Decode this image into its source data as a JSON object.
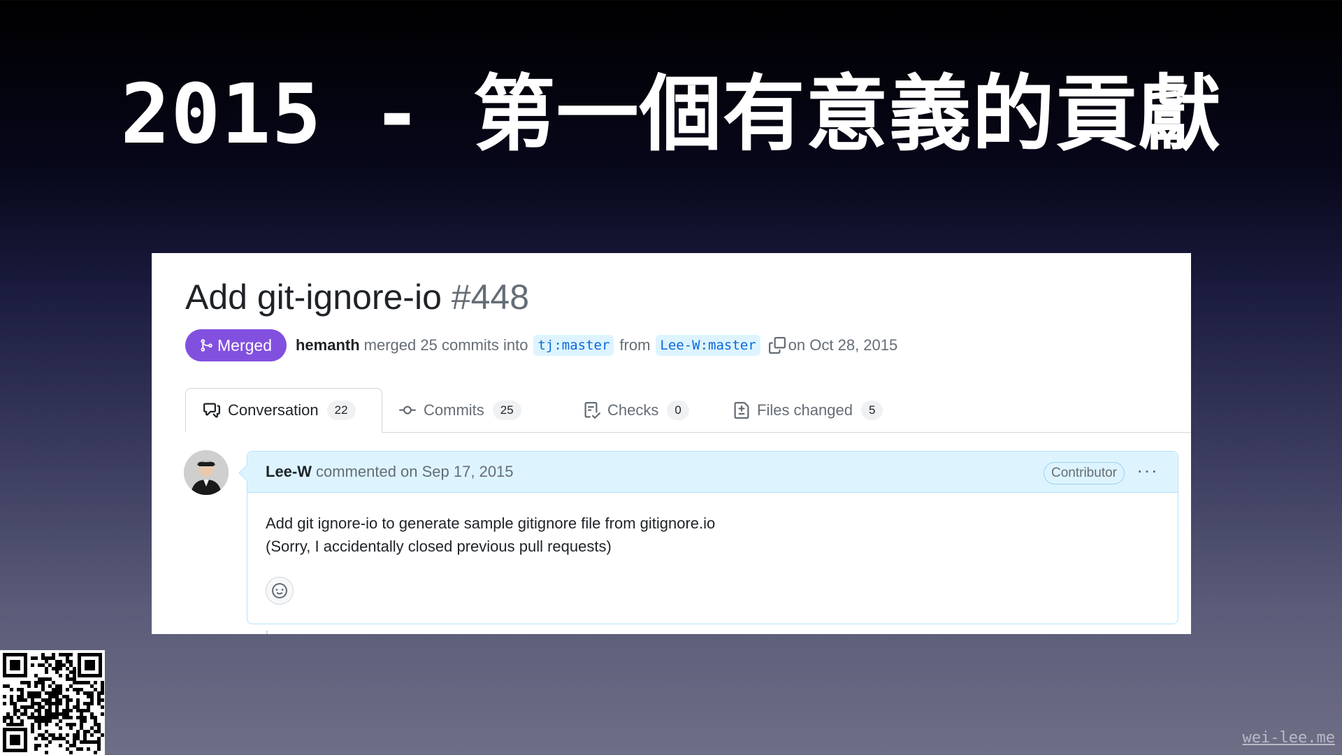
{
  "slide": {
    "title": "2015 - 第一個有意義的貢獻",
    "footer_url": "wei-lee.me"
  },
  "pull_request": {
    "title": "Add git-ignore-io",
    "number": "#448",
    "state_label": "Merged",
    "merged_by": "hemanth",
    "merge_text": "merged 25 commits into",
    "base_branch": "tj:master",
    "from_text": "from",
    "head_branch": "Lee-W:master",
    "date_text": "on Oct 28, 2015"
  },
  "tabs": [
    {
      "label": "Conversation",
      "count": "22",
      "icon": "comment-discussion-icon",
      "active": true
    },
    {
      "label": "Commits",
      "count": "25",
      "icon": "git-commit-icon",
      "active": false
    },
    {
      "label": "Checks",
      "count": "0",
      "icon": "checklist-icon",
      "active": false
    },
    {
      "label": "Files changed",
      "count": "5",
      "icon": "file-diff-icon",
      "active": false
    }
  ],
  "comment": {
    "author": "Lee-W",
    "meta": "commented on Sep 17, 2015",
    "role_badge": "Contributor",
    "more_label": "···",
    "body_lines": [
      "Add git ignore-io to generate sample gitignore file from gitignore.io",
      "(Sorry, I accidentally closed previous pull requests)"
    ]
  },
  "colors": {
    "merged_purple": "#8250df",
    "branch_bg": "#ddf4ff",
    "branch_text": "#0969da",
    "comment_header_bg": "#ddf4ff"
  }
}
